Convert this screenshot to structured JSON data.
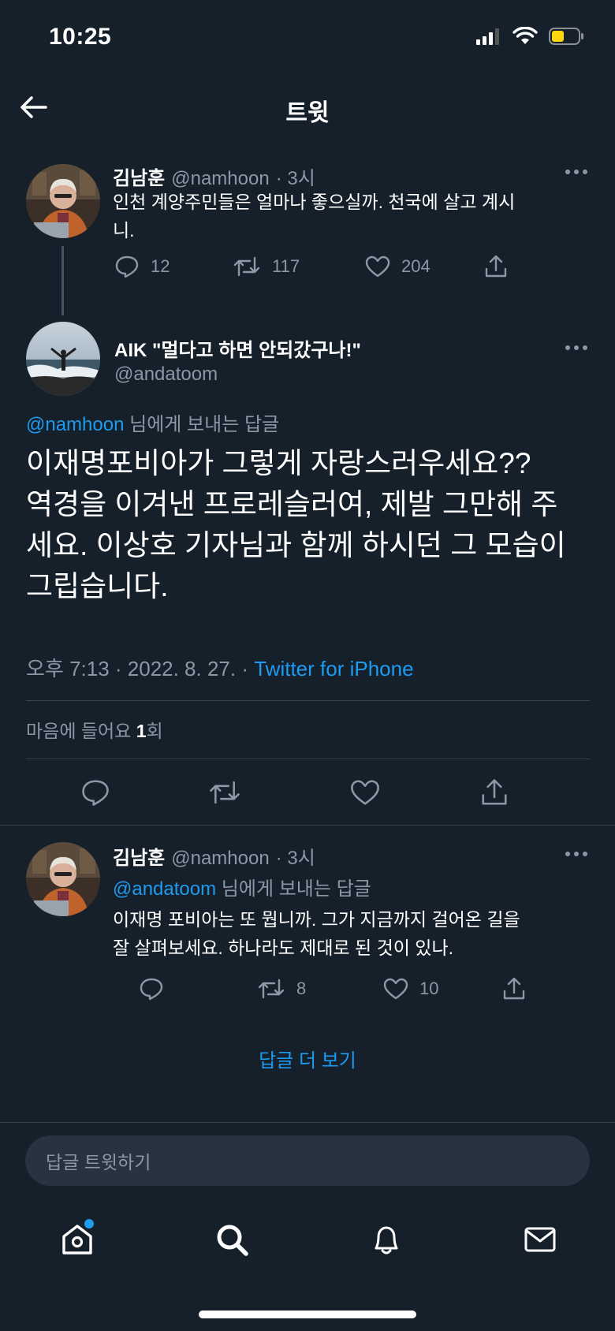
{
  "status_bar": {
    "time": "10:25"
  },
  "header": {
    "title": "트윗"
  },
  "parent_tweet": {
    "name": "김남훈",
    "handle": "@namhoon",
    "time": "· 3시",
    "text_line1": "인천 계양주민들은 얼마나 좋으실까. 천국에 살고 계시",
    "text_line2": "니.",
    "replies": "12",
    "retweets": "117",
    "likes": "204"
  },
  "main_tweet": {
    "name": "AIK \"멀다고 하면 안되갔구나!\"",
    "handle": "@andatoom",
    "reply_to_handle": "@namhoon",
    "reply_to_suffix": "님에게 보내는 답글",
    "text_lines": [
      "이재명포비아가 그렇게 자랑스러우세요??",
      "역경을 이겨낸 프로레슬러여, 제발 그만해 주",
      "세요. 이상호 기자님과 함께 하시던 그 모습이",
      "그립습니다."
    ],
    "timestamp": "오후 7:13 · 2022. 8. 27. ·",
    "source": "Twitter for iPhone",
    "likes_label": "마음에 들어요",
    "likes_count": "1",
    "likes_unit": "회"
  },
  "reply_tweet": {
    "name": "김남훈",
    "handle": "@namhoon",
    "time": "· 3시",
    "reply_to_handle": "@andatoom",
    "reply_to_suffix": "님에게 보내는 답글",
    "text_line1": "이재명 포비아는 또 뭡니까. 그가 지금까지 걸어온 길을",
    "text_line2": "잘 살펴보세요. 하나라도 제대로 된 것이 있나.",
    "retweets": "8",
    "likes": "10"
  },
  "more_replies_label": "답글 더 보기",
  "compose": {
    "placeholder": "답글 트윗하기"
  },
  "colors": {
    "background": "#15202b",
    "accent": "#1d9bf0",
    "muted": "#8b98a5",
    "divider": "#38444d"
  }
}
